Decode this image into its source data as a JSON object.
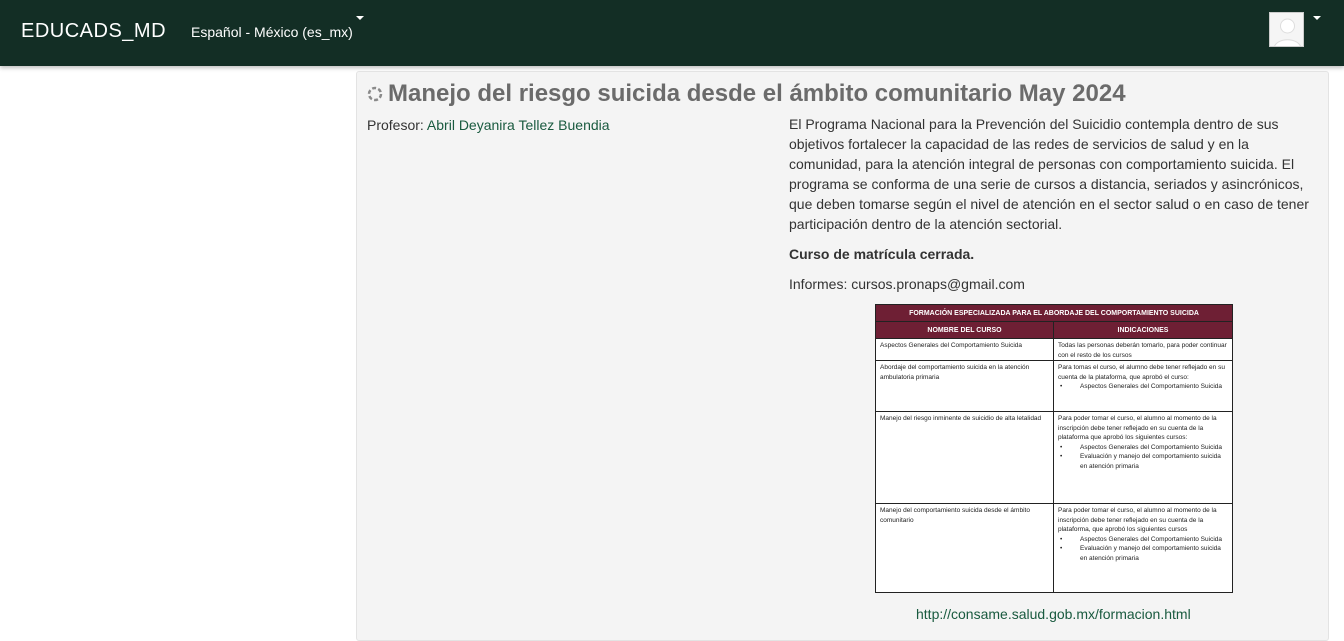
{
  "navbar": {
    "brand": "EDUCADS_MD",
    "language": "Español - México (es_mx)"
  },
  "course": {
    "title": "Manejo del riesgo suicida desde el ámbito comunitario May 2024",
    "teacher_label": "Profesor: ",
    "teacher_name": "Abril Deyanira Tellez Buendia",
    "summary_paragraph": "El Programa Nacional para la Prevención del Suicidio contempla dentro de sus objetivos fortalecer la capacidad de las redes de servicios de salud y en la comunidad, para la atención integral de personas con comportamiento suicida. El programa se conforma de una serie de cursos a distancia, seriados y asincrónicos, que deben tomarse según el nivel de atención en el sector salud o en caso de tener participación dentro de la atención sectorial.",
    "closed_enrollment": "Curso de matrícula cerrada.",
    "contact": "Informes: cursos.pronaps@gmail.com",
    "link": "http://consame.salud.gob.mx/formacion.html"
  },
  "table": {
    "title": "FORMACIÓN ESPECIALIZADA PARA EL ABORDAJE DEL COMPORTAMIENTO SUICIDA",
    "col1_header": "NOMBRE DEL CURSO",
    "col2_header": "INDICACIONES",
    "rows": [
      {
        "name": "Aspectos Generales del Comportamiento Suicida",
        "text": "Todas las personas deberán tomarlo, para poder continuar con el resto de los cursos",
        "bullets": []
      },
      {
        "name": "Abordaje del comportamiento suicida en la atención ambulatoria primaria",
        "text": "Para tomas el curso, el alumno debe tener reflejado en su cuenta de la plataforma, que aprobó el curso:",
        "bullets": [
          "Aspectos Generales del Comportamiento Suicida"
        ]
      },
      {
        "name": "Manejo del riesgo inminente de suicidio de alta letalidad",
        "text": "Para poder tomar el curso, el alumno al momento de la inscripción debe tener reflejado en su cuenta de la plataforma que aprobó los siguientes cursos:",
        "bullets": [
          "Aspectos Generales del Comportamiento Suicida",
          "Evaluación y manejo del comportamiento suicida en atención primaria"
        ]
      },
      {
        "name": "Manejo del comportamiento suicida desde el ámbito comunitario",
        "text": "Para poder tomar el curso, el alumno al momento de la inscripción debe tener reflejado en su cuenta de la plataforma, que aprobó los siguientes cursos",
        "bullets": [
          "Aspectos Generales del Comportamiento Suicida",
          "Evaluación y manejo del comportamiento suicida en atención primaria"
        ]
      }
    ]
  },
  "colors": {
    "navbar": "#132e25",
    "link": "#195a3f",
    "table_header": "#6e1f34"
  },
  "icons": [
    "course-icon",
    "avatar-icon",
    "chevron-down-icon"
  ]
}
